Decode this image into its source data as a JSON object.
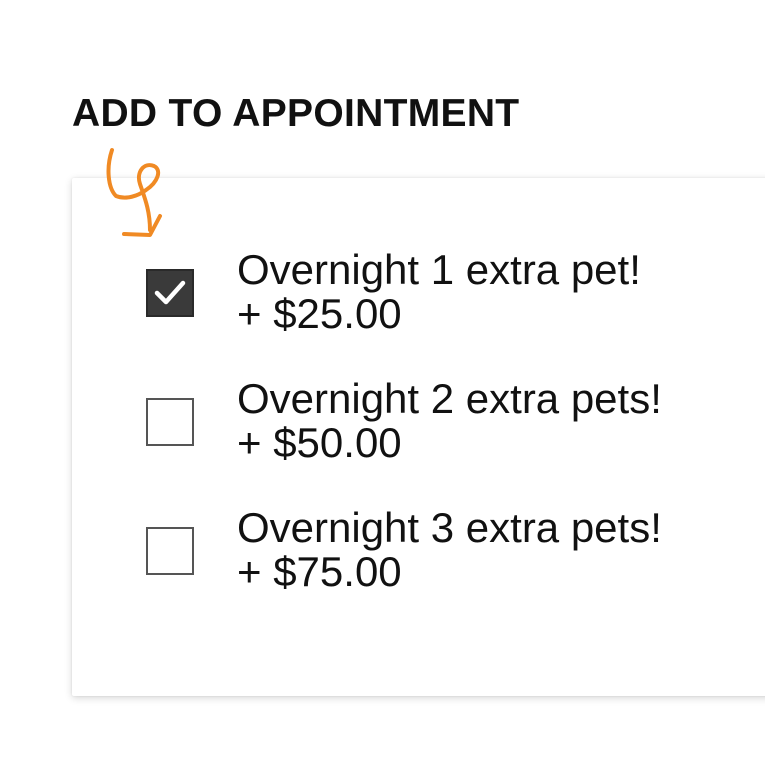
{
  "section": {
    "title": "ADD TO APPOINTMENT"
  },
  "annotation": {
    "icon": "hand-drawn-arrow-icon",
    "color": "#F08A24"
  },
  "options": [
    {
      "label": "Overnight 1 extra pet!",
      "price": "+ $25.00",
      "checked": true
    },
    {
      "label": "Overnight 2 extra pets!",
      "price": "+ $50.00",
      "checked": false
    },
    {
      "label": "Overnight 3 extra pets!",
      "price": "+ $75.00",
      "checked": false
    }
  ],
  "colors": {
    "checked_fill": "#3A3A3A",
    "checkbox_border": "#555555",
    "text": "#111111",
    "card_background": "#FFFFFF"
  }
}
